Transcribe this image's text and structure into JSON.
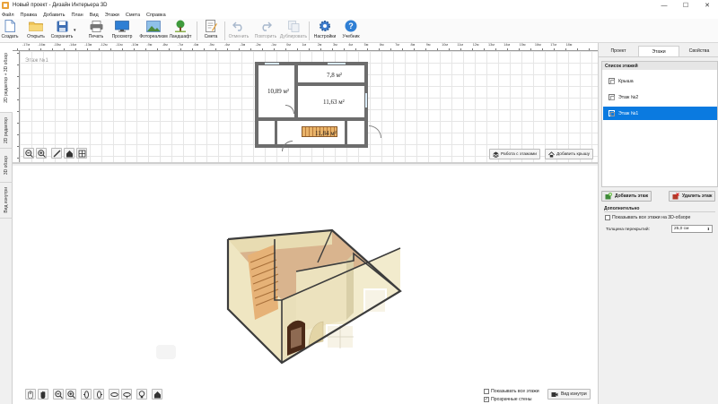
{
  "window": {
    "title": "Новый проект - Дизайн Интерьера 3D"
  },
  "menu": [
    "Файл",
    "Правка",
    "Добавить",
    "План",
    "Вид",
    "Этажи",
    "Смета",
    "Справка"
  ],
  "toolbar": {
    "create": "Создать",
    "open": "Открыть",
    "save": "Сохранить",
    "print": "Печать",
    "preview": "Просмотр",
    "photorealism": "Фотореализм",
    "landscape": "Ландшафт",
    "estimate": "Смета",
    "undo": "Отменить",
    "redo": "Повторить",
    "duplicate": "Дублировать",
    "settings": "Настройки",
    "tutorial": "Учебник"
  },
  "left_tabs": [
    "2D редактор + 3D обзор",
    "2D редактор",
    "3D обзор",
    "Вид изнутри"
  ],
  "plan": {
    "floor_label": "Этаж №1",
    "ruler": [
      "-17м",
      "-16м",
      "-15м",
      "-14м",
      "-13м",
      "-12м",
      "-11м",
      "-10м",
      "-9м",
      "-8м",
      "-7м",
      "-6м",
      "-5м",
      "-4м",
      "-3м",
      "-2м",
      "-1м",
      "0м",
      "1м",
      "2м",
      "3м",
      "4м",
      "5м",
      "6м",
      "7м",
      "8м",
      "9м",
      "10м",
      "11м",
      "12м",
      "13м",
      "14м",
      "15м",
      "16м",
      "17м",
      "18м"
    ],
    "rooms": {
      "r1": "10,89 м²",
      "r2": "7,8 м²",
      "r3": "11,63 м²",
      "r4": "11,84 м²"
    },
    "btn_floors": "Работа с этажами",
    "btn_roof": "Добавить крышу"
  },
  "view3d": {
    "show_all_floors": "Показывать все этажи",
    "show_all_floors_checked": false,
    "transparent_walls": "Прозрачные стены",
    "transparent_walls_checked": true,
    "btn_inside": "Вид изнутри"
  },
  "right_panel": {
    "tabs": [
      "Проект",
      "Этажи",
      "Свойства"
    ],
    "active_tab": "Этажи",
    "list_title": "Список этажей",
    "floors": [
      "Крыша",
      "Этаж №2",
      "Этаж №1"
    ],
    "selected_floor": "Этаж №1",
    "btn_add": "Добавить этаж",
    "btn_delete": "Удалить этаж",
    "extra_title": "Дополнительно",
    "show_all_3d": "Показывать все этажи на 3D-обзоре",
    "thickness_label": "Толщина перекрытий:",
    "thickness_value": "25,0 см"
  },
  "colors": {
    "selection": "#0a7ae0",
    "wall": "#6d6d6d",
    "wallpaper": "#efe6c2",
    "floor": "#d9b48e"
  }
}
